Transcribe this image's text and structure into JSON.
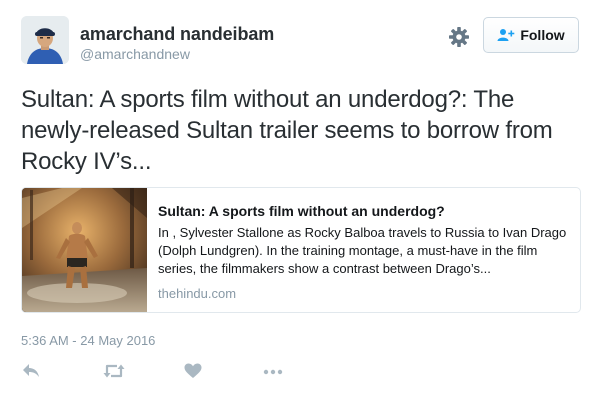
{
  "author": {
    "display_name": "amarchand nandeibam",
    "handle": "@amarchandnew"
  },
  "header": {
    "follow_label": "Follow",
    "settings_icon": "gear-icon",
    "follow_icon": "person-plus-icon"
  },
  "tweet": {
    "text": "Sultan: A sports film without an underdog?: The newly-released Sultan trailer seems to borrow from Rocky IV’s...",
    "timestamp": "5:36 AM - 24 May 2016"
  },
  "card": {
    "title": "Sultan: A sports film without an underdog?",
    "description": "In , Sylvester Stallone as Rocky Balboa travels to Russia to Ivan Drago (Dolph Lundgren). In the training montage, a must-have in the film series, the filmmakers show a contrast between Drago’s...",
    "domain": "thehindu.com",
    "image_icon": "boxer-photo"
  },
  "actions": [
    "reply-icon",
    "retweet-icon",
    "like-icon",
    "more-icon"
  ],
  "colors": {
    "text": "#292f33",
    "secondary": "#8899a6",
    "accent": "#1da1f2",
    "border": "#e1e8ed"
  }
}
